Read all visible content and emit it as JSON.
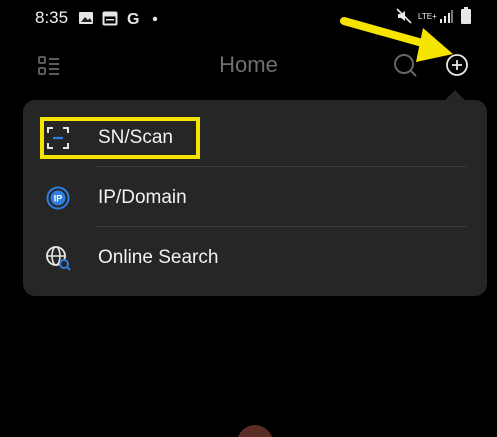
{
  "status_bar": {
    "time": "8:35",
    "network_label": "LTE+",
    "icons": [
      "gallery-icon",
      "calendar-icon",
      "google-icon",
      "dot-icon",
      "mute-icon",
      "signal-icon",
      "battery-icon"
    ]
  },
  "app_bar": {
    "title": "Home",
    "icons": [
      "list-icon",
      "search-icon",
      "add-icon"
    ]
  },
  "menu": {
    "items": [
      {
        "label": "SN/Scan",
        "icon": "scan-icon",
        "highlighted": true
      },
      {
        "label": "IP/Domain",
        "icon": "ip-icon"
      },
      {
        "label": "Online Search",
        "icon": "globe-search-icon"
      }
    ]
  },
  "annotation_colors": {
    "highlight": "#f5e400",
    "arrow": "#f5e400"
  }
}
